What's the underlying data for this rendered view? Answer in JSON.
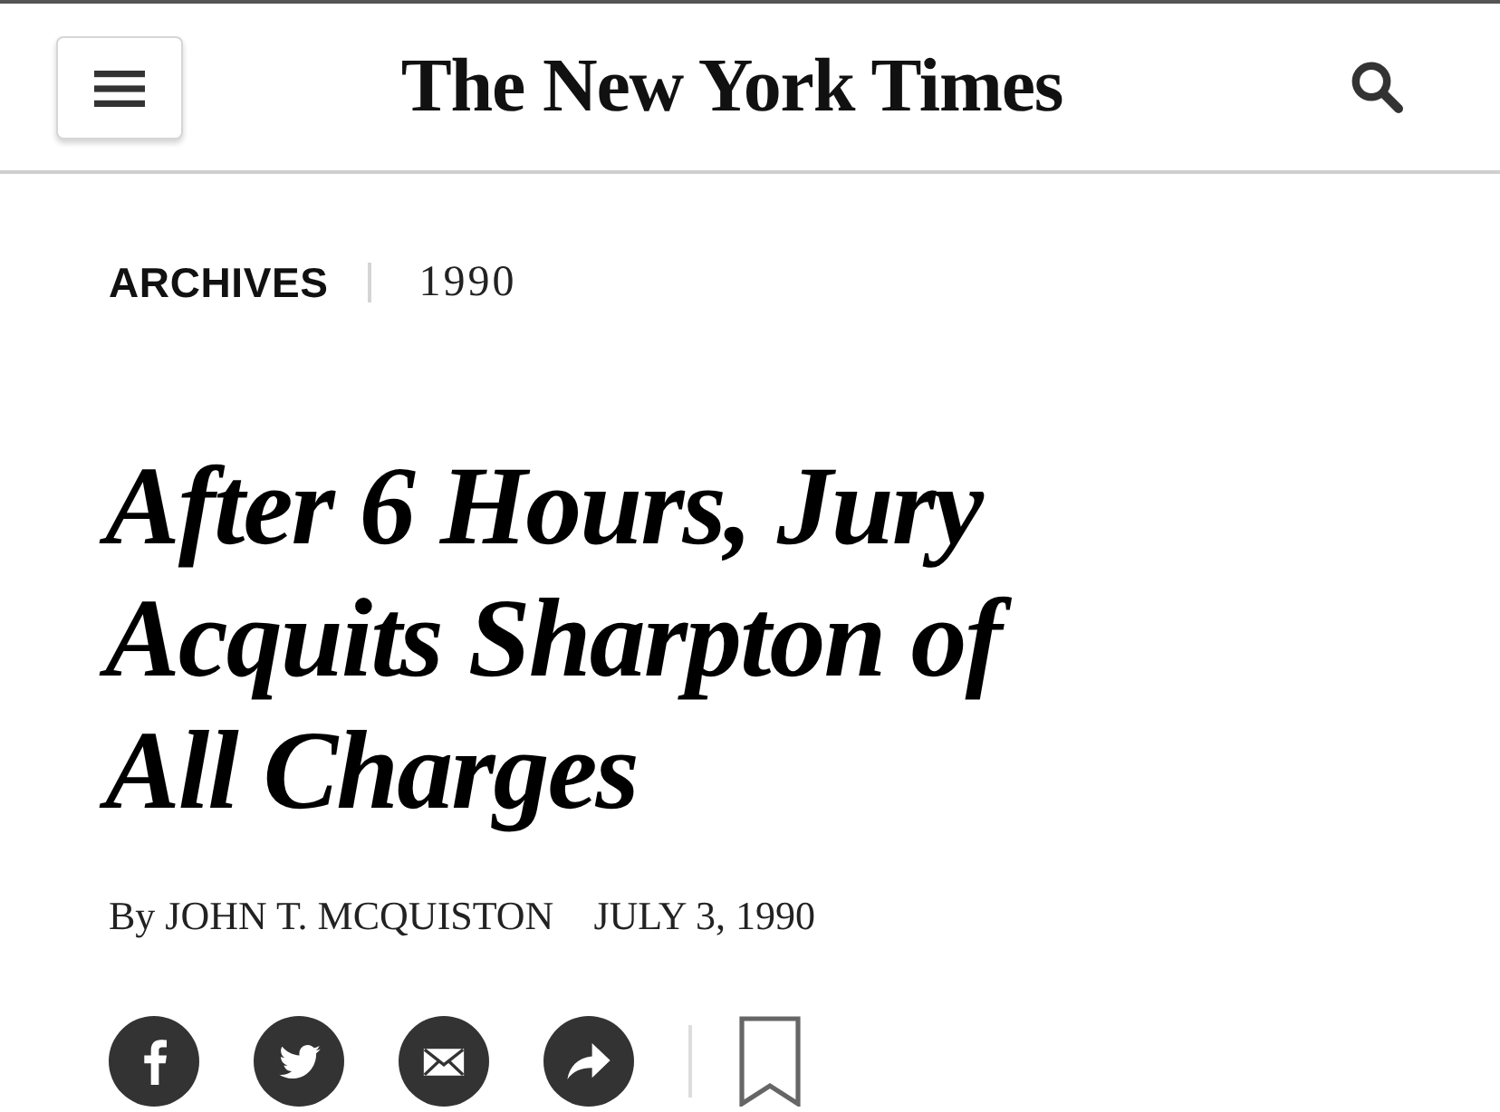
{
  "header": {
    "logo": "The New York Times"
  },
  "section": {
    "label": "ARCHIVES",
    "year": "1990"
  },
  "headline": "After 6 Hours, Jury Acquits Sharpton of All Charges",
  "byline": {
    "author": "By JOHN T. MCQUISTON",
    "date": "JULY 3, 1990"
  },
  "share_buttons": [
    {
      "kind": "facebook"
    },
    {
      "kind": "twitter"
    },
    {
      "kind": "email"
    },
    {
      "kind": "share"
    }
  ],
  "bookmark": {
    "saved": false
  }
}
